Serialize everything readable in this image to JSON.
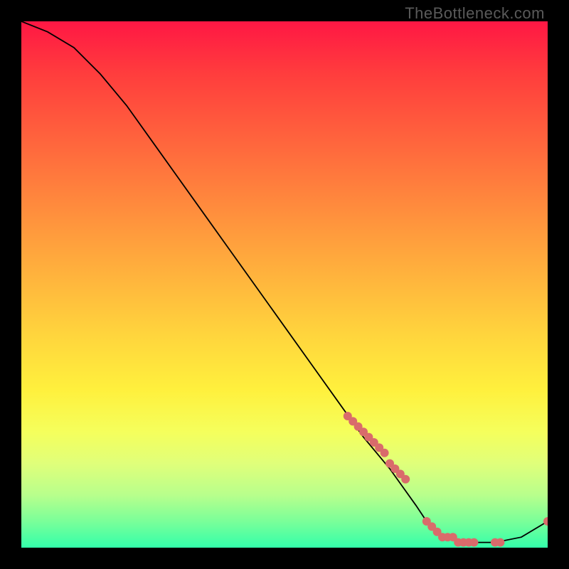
{
  "watermark": "TheBottleneck.com",
  "chart_data": {
    "type": "line",
    "title": "",
    "xlabel": "",
    "ylabel": "",
    "xlim": [
      0,
      100
    ],
    "ylim": [
      0,
      100
    ],
    "series": [
      {
        "name": "bottleneck-curve",
        "x": [
          0,
          5,
          10,
          15,
          20,
          25,
          30,
          35,
          40,
          45,
          50,
          55,
          60,
          65,
          70,
          75,
          77,
          80,
          85,
          90,
          95,
          100
        ],
        "values": [
          100,
          98,
          95,
          90,
          84,
          77,
          70,
          63,
          56,
          49,
          42,
          35,
          28,
          21,
          15,
          8,
          5,
          2,
          1,
          1,
          2,
          5
        ]
      }
    ],
    "scatter_points": {
      "name": "gpu-marks",
      "color": "#d96b6b",
      "x": [
        62,
        63,
        64,
        65,
        66,
        67,
        68,
        69,
        70,
        71,
        72,
        73,
        77,
        78,
        79,
        80,
        81,
        82,
        83,
        84,
        85,
        86,
        90,
        91,
        100
      ],
      "values": [
        25,
        24,
        23,
        22,
        21,
        20,
        19,
        18,
        16,
        15,
        14,
        13,
        5,
        4,
        3,
        2,
        2,
        2,
        1,
        1,
        1,
        1,
        1,
        1,
        5
      ]
    }
  }
}
